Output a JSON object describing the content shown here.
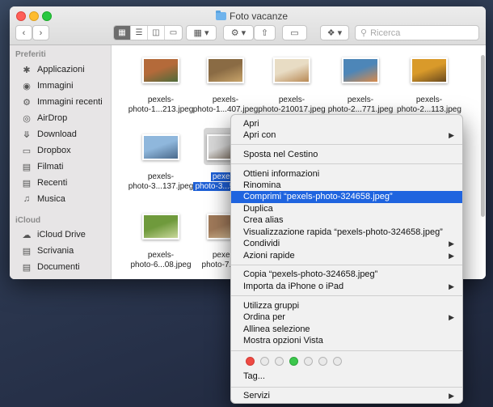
{
  "window": {
    "title": "Foto vacanze"
  },
  "toolbar": {
    "search_placeholder": "Ricerca"
  },
  "sidebar": {
    "favorites_heading": "Preferiti",
    "icloud_heading": "iCloud",
    "favorites": [
      {
        "label": "Applicazioni",
        "icon": "applications-icon"
      },
      {
        "label": "Immagini",
        "icon": "camera-icon"
      },
      {
        "label": "Immagini recenti",
        "icon": "gear-icon"
      },
      {
        "label": "AirDrop",
        "icon": "airdrop-icon"
      },
      {
        "label": "Download",
        "icon": "download-icon"
      },
      {
        "label": "Dropbox",
        "icon": "folder-icon"
      },
      {
        "label": "Filmati",
        "icon": "film-icon"
      },
      {
        "label": "Recenti",
        "icon": "recent-icon"
      },
      {
        "label": "Musica",
        "icon": "music-icon"
      }
    ],
    "icloud": [
      {
        "label": "iCloud Drive",
        "icon": "cloud-icon"
      },
      {
        "label": "Scrivania",
        "icon": "desktop-icon"
      },
      {
        "label": "Documenti",
        "icon": "document-icon"
      }
    ]
  },
  "files": [
    {
      "line1": "pexels-",
      "line2": "photo-1...213.jpeg",
      "colors": [
        "#b46a3a",
        "#4f6b3a"
      ]
    },
    {
      "line1": "pexels-",
      "line2": "photo-1...407.jpeg",
      "colors": [
        "#8a6b44",
        "#c8a46a"
      ]
    },
    {
      "line1": "pexels-",
      "line2": "photo-210017.jpeg",
      "colors": [
        "#e8dcc4",
        "#b98a55"
      ]
    },
    {
      "line1": "pexels-",
      "line2": "photo-2...771.jpeg",
      "colors": [
        "#4d86b8",
        "#d88a4a"
      ]
    },
    {
      "line1": "pexels-",
      "line2": "photo-2...113.jpeg",
      "colors": [
        "#d99a2a",
        "#6a4a1e"
      ]
    },
    {
      "line1": "pexels-",
      "line2": "photo-3...137.jpeg",
      "colors": [
        "#8fb7dc",
        "#4a6a8c"
      ]
    },
    {
      "line1": "pexels-",
      "line2": "photo-3...58.jpeg",
      "colors": [
        "#d8d8d8",
        "#7a6a5a"
      ],
      "selected": true
    },
    {
      "line1": "pexels-",
      "line2": "photo-6...08.jpeg",
      "colors": [
        "#6f9a3c",
        "#c9d89a"
      ]
    },
    {
      "line1": "pexels-",
      "line2": "photo-7...521",
      "colors": [
        "#a07a5a",
        "#e0c8a0"
      ]
    }
  ],
  "context_menu": {
    "items": [
      {
        "label": "Apri"
      },
      {
        "label": "Apri con",
        "submenu": true
      },
      {
        "label": "Sposta nel Cestino"
      },
      {
        "label": "Ottieni informazioni"
      },
      {
        "label": "Rinomina"
      },
      {
        "label": "Comprimi “pexels-photo-324658.jpeg”",
        "highlighted": true
      },
      {
        "label": "Duplica"
      },
      {
        "label": "Crea alias"
      },
      {
        "label": "Visualizzazione rapida “pexels-photo-324658.jpeg”"
      },
      {
        "label": "Condividi",
        "submenu": true
      },
      {
        "label": "Azioni rapide",
        "submenu": true
      },
      {
        "label": "Copia “pexels-photo-324658.jpeg”"
      },
      {
        "label": "Importa da iPhone o iPad",
        "submenu": true
      },
      {
        "label": "Utilizza gruppi"
      },
      {
        "label": "Ordina per",
        "submenu": true
      },
      {
        "label": "Allinea selezione"
      },
      {
        "label": "Mostra opzioni Vista"
      },
      {
        "label": "Tag..."
      },
      {
        "label": "Servizi",
        "submenu": true
      }
    ],
    "tag_colors": [
      "#ee4a43",
      "#e9e9e9",
      "#e9e9e9",
      "#3cc74c",
      "#e9e9e9",
      "#e9e9e9",
      "#e9e9e9"
    ]
  },
  "colors": {
    "accent": "#1f64df",
    "selection": "#1d5fd6"
  }
}
